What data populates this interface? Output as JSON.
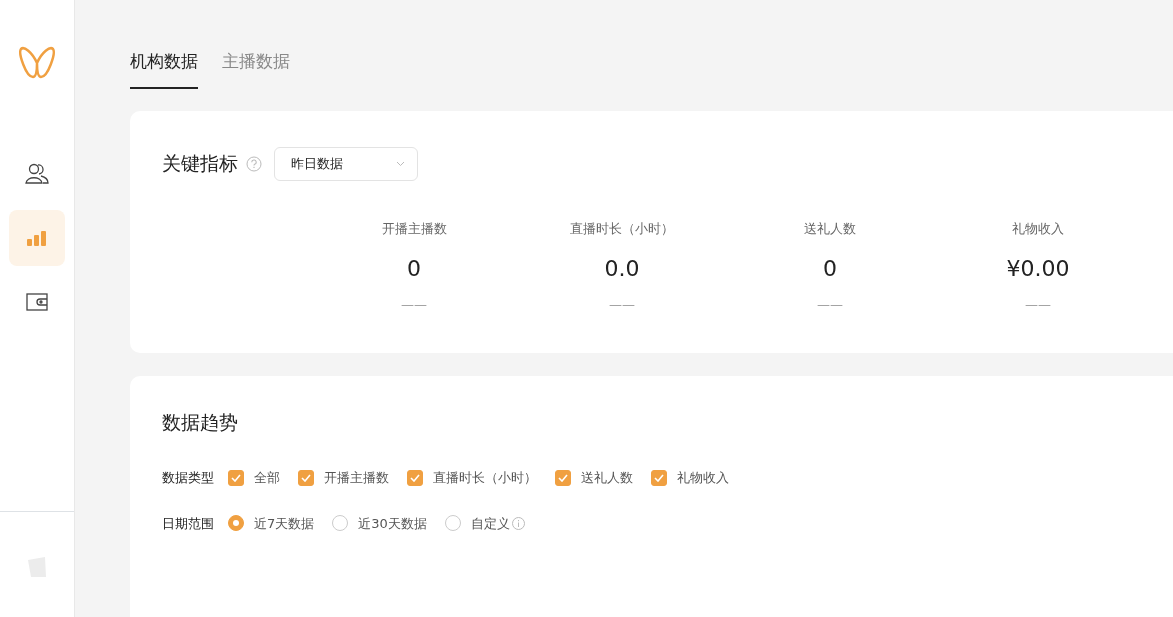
{
  "sidebar": {
    "items": [
      {
        "kind": "users",
        "selected": false
      },
      {
        "kind": "chart",
        "selected": true
      },
      {
        "kind": "wallet",
        "selected": false
      }
    ]
  },
  "tabs": [
    {
      "label": "机构数据",
      "selected": true
    },
    {
      "label": "主播数据",
      "selected": false
    }
  ],
  "key_metrics": {
    "title": "关键指标",
    "select": {
      "value": "昨日数据"
    },
    "metrics": [
      {
        "label": "开播主播数",
        "value": "0",
        "change": "——"
      },
      {
        "label": "直播时长（小时）",
        "value": "0.0",
        "change": "——"
      },
      {
        "label": "送礼人数",
        "value": "0",
        "change": "——"
      },
      {
        "label": "礼物收入",
        "value": "¥0.00",
        "change": "——"
      }
    ]
  },
  "trend": {
    "title": "数据趋势",
    "data_type": {
      "label": "数据类型",
      "options": [
        {
          "label": "全部",
          "checked": true
        },
        {
          "label": "开播主播数",
          "checked": true
        },
        {
          "label": "直播时长（小时）",
          "checked": true
        },
        {
          "label": "送礼人数",
          "checked": true
        },
        {
          "label": "礼物收入",
          "checked": true
        }
      ]
    },
    "date_range": {
      "label": "日期范围",
      "options": [
        {
          "label": "近7天数据",
          "selected": true,
          "info": false
        },
        {
          "label": "近30天数据",
          "selected": false,
          "info": false
        },
        {
          "label": "自定义",
          "selected": false,
          "info": true
        }
      ]
    }
  }
}
